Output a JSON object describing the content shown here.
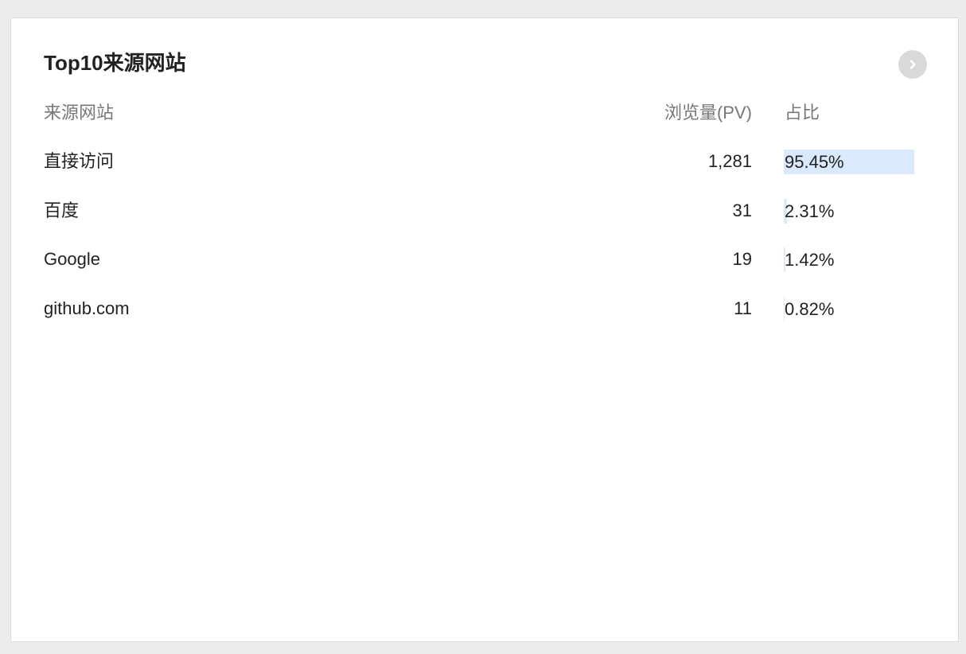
{
  "card": {
    "title": "Top10来源网站"
  },
  "table": {
    "headers": {
      "source": "来源网站",
      "pv": "浏览量(PV)",
      "ratio": "占比"
    },
    "rows": [
      {
        "source": "直接访问",
        "pv": "1,281",
        "ratio": "95.45%",
        "ratio_value": 0.9545
      },
      {
        "source": "百度",
        "pv": "31",
        "ratio": "2.31%",
        "ratio_value": 0.0231
      },
      {
        "source": "Google",
        "pv": "19",
        "ratio": "1.42%",
        "ratio_value": 0.0142
      },
      {
        "source": "github.com",
        "pv": "11",
        "ratio": "0.82%",
        "ratio_value": 0.0082
      }
    ]
  },
  "colors": {
    "bar": "#dbe9fc",
    "button": "#d9d9d9"
  },
  "icons": {
    "more": "chevron-right-icon"
  }
}
